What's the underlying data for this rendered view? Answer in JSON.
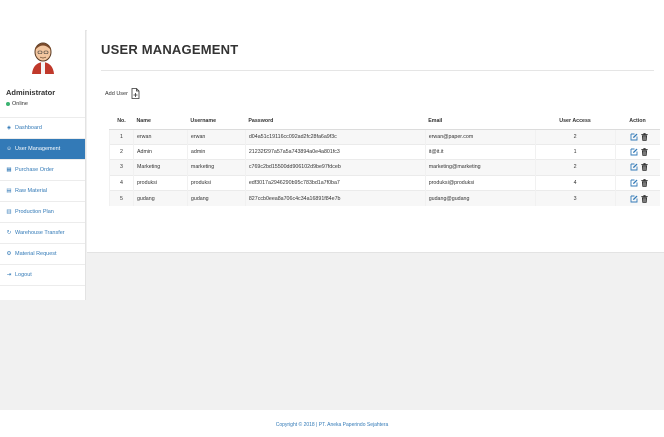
{
  "app": {
    "page_title": "USER MANAGEMENT",
    "footer": "Copyright © 2018 | PT. Aneka Paperindo Sejahtera"
  },
  "sidebar": {
    "user_name": "Administrator",
    "status": "Online",
    "items": [
      {
        "label": "Dashboard",
        "icon": "dashboard-icon",
        "glyph": "◈",
        "active": false
      },
      {
        "label": "User Management",
        "icon": "user-icon",
        "glyph": "☺",
        "active": true
      },
      {
        "label": "Purchase Order",
        "icon": "table-icon",
        "glyph": "▦",
        "active": false
      },
      {
        "label": "Raw Material",
        "icon": "list-icon",
        "glyph": "▤",
        "active": false
      },
      {
        "label": "Production Plan",
        "icon": "calendar-icon",
        "glyph": "▥",
        "active": false
      },
      {
        "label": "Warehouse Transfer",
        "icon": "refresh-icon",
        "glyph": "↻",
        "active": false
      },
      {
        "label": "Material Request",
        "icon": "gear-icon",
        "glyph": "⚙",
        "active": false
      },
      {
        "label": "Logout",
        "icon": "logout-icon",
        "glyph": "⇥",
        "active": false
      }
    ]
  },
  "toolbar": {
    "add_user_label": "Add User"
  },
  "table": {
    "columns": [
      "No.",
      "Name",
      "Username",
      "Password",
      "Email",
      "User Access",
      "Action"
    ],
    "rows": [
      {
        "no": "1",
        "name": "erwan",
        "username": "erwan",
        "password": "d04a51c19116cc092ad2fc28fa6a9f3c",
        "email": "erwan@paper.com",
        "access": "2"
      },
      {
        "no": "2",
        "name": "Admin",
        "username": "admin",
        "password": "21232f297a57a5a743894a0e4a801fc3",
        "email": "it@it.it",
        "access": "1"
      },
      {
        "no": "3",
        "name": "Marketing",
        "username": "marketing",
        "password": "c769c2bd15500dd906102d9be97fdceb",
        "email": "marketing@marketing",
        "access": "2"
      },
      {
        "no": "4",
        "name": "produksi",
        "username": "produksi",
        "password": "edf3017a2946290b95c783bd1a7f0ba7",
        "email": "produksi@produksi",
        "access": "4"
      },
      {
        "no": "5",
        "name": "gudang",
        "username": "gudang",
        "password": "827ccb0eea8a706c4c34a16891f84e7b",
        "email": "gudang@gudang",
        "access": "3"
      }
    ]
  },
  "colors": {
    "accent": "#337ab7",
    "online": "#3cb371"
  }
}
